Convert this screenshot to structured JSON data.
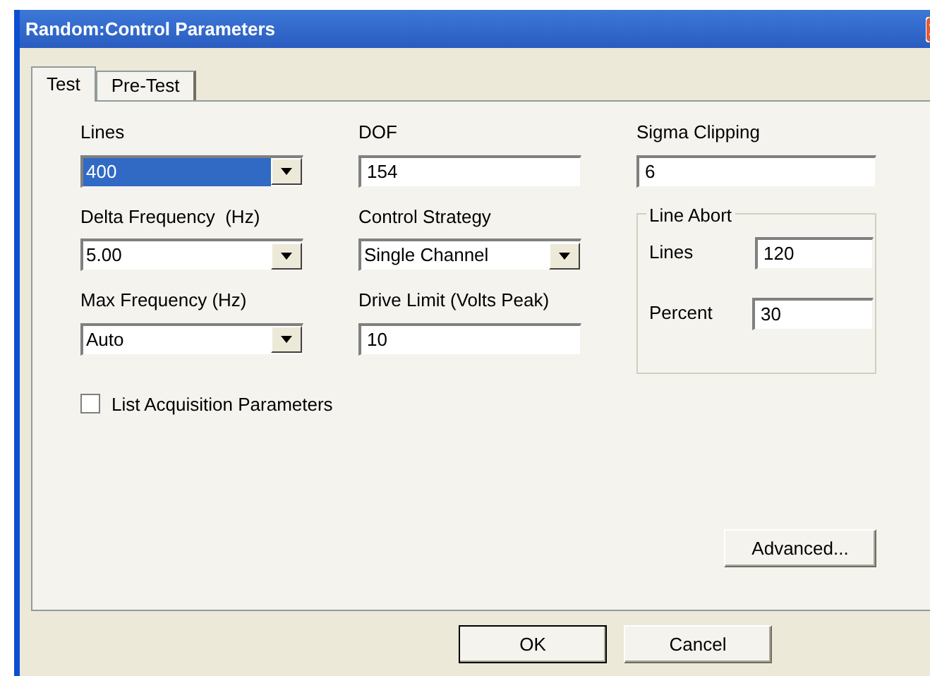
{
  "window": {
    "title": "Random:Control Parameters"
  },
  "tabs": [
    {
      "label": "Test",
      "selected": true
    },
    {
      "label": "Pre-Test",
      "selected": false
    }
  ],
  "columns": [
    {
      "fields": [
        {
          "kind": "combo",
          "label": "Lines",
          "value": "400",
          "highlighted": true
        },
        {
          "kind": "combo",
          "label": "Delta Frequency  (Hz)",
          "value": "5.00",
          "highlighted": false
        },
        {
          "kind": "combo",
          "label": "Max Frequency (Hz)",
          "value": "Auto",
          "highlighted": false
        }
      ]
    },
    {
      "fields": [
        {
          "kind": "text",
          "label": "DOF",
          "value": "154"
        },
        {
          "kind": "combo",
          "label": "Control Strategy",
          "value": "Single Channel",
          "highlighted": false
        },
        {
          "kind": "text",
          "label": "Drive Limit (Volts Peak)",
          "value": "10"
        }
      ]
    }
  ],
  "sigma_clipping": {
    "label": "Sigma Clipping",
    "value": "6"
  },
  "line_abort": {
    "title": "Line Abort",
    "fields": [
      {
        "label": "Lines",
        "value": "120"
      },
      {
        "label": "Percent",
        "value": "30"
      }
    ]
  },
  "list_acquisition": {
    "label": "List Acquisition Parameters",
    "checked": false
  },
  "advanced_button": "Advanced...",
  "buttons": [
    "OK",
    "Cancel"
  ]
}
